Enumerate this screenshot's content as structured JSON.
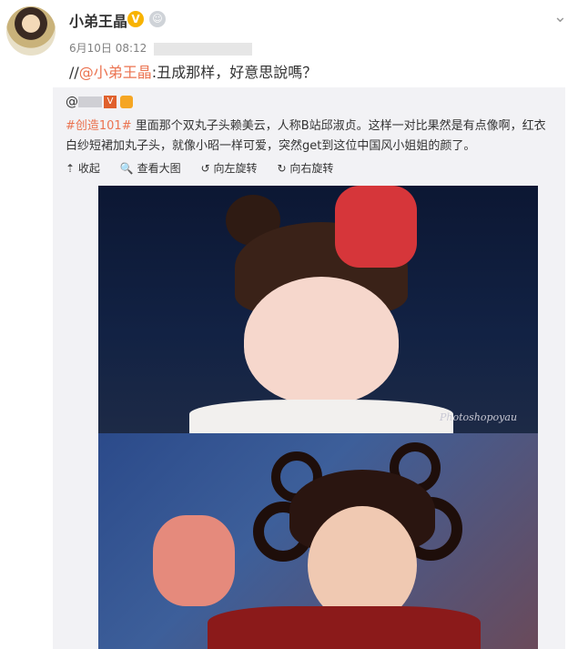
{
  "post": {
    "author": "小弟王晶",
    "verified_badge": "V",
    "level_icon": "🙂",
    "timestamp": "6月10日 08:12",
    "text_prefix": "//",
    "mention": "@小弟王晶",
    "text_suffix": ":丑成那样，好意思說嗎？",
    "menu_icon": "chevron-down-icon"
  },
  "quoted": {
    "author_prefix": "@",
    "v_badge": "V",
    "hashtag": "#创造101#",
    "text": " 里面那个双丸子头赖美云，人称B站邱淑贞。这样一对比果然是有点像啊，红衣白纱短裙加丸子头，就像小昭一样可爱，突然get到这位中国风小姐姐的颜了。",
    "actions": {
      "collapse": "⇡ 收起",
      "view_large": "🔍 查看大图",
      "rotate_left": "↺ 向左旋转",
      "rotate_right": "↻ 向右旋转"
    },
    "photo_watermark": "Photoshopoyau"
  },
  "colors": {
    "accent": "#eb7350",
    "quote_bg": "#f2f2f5"
  }
}
